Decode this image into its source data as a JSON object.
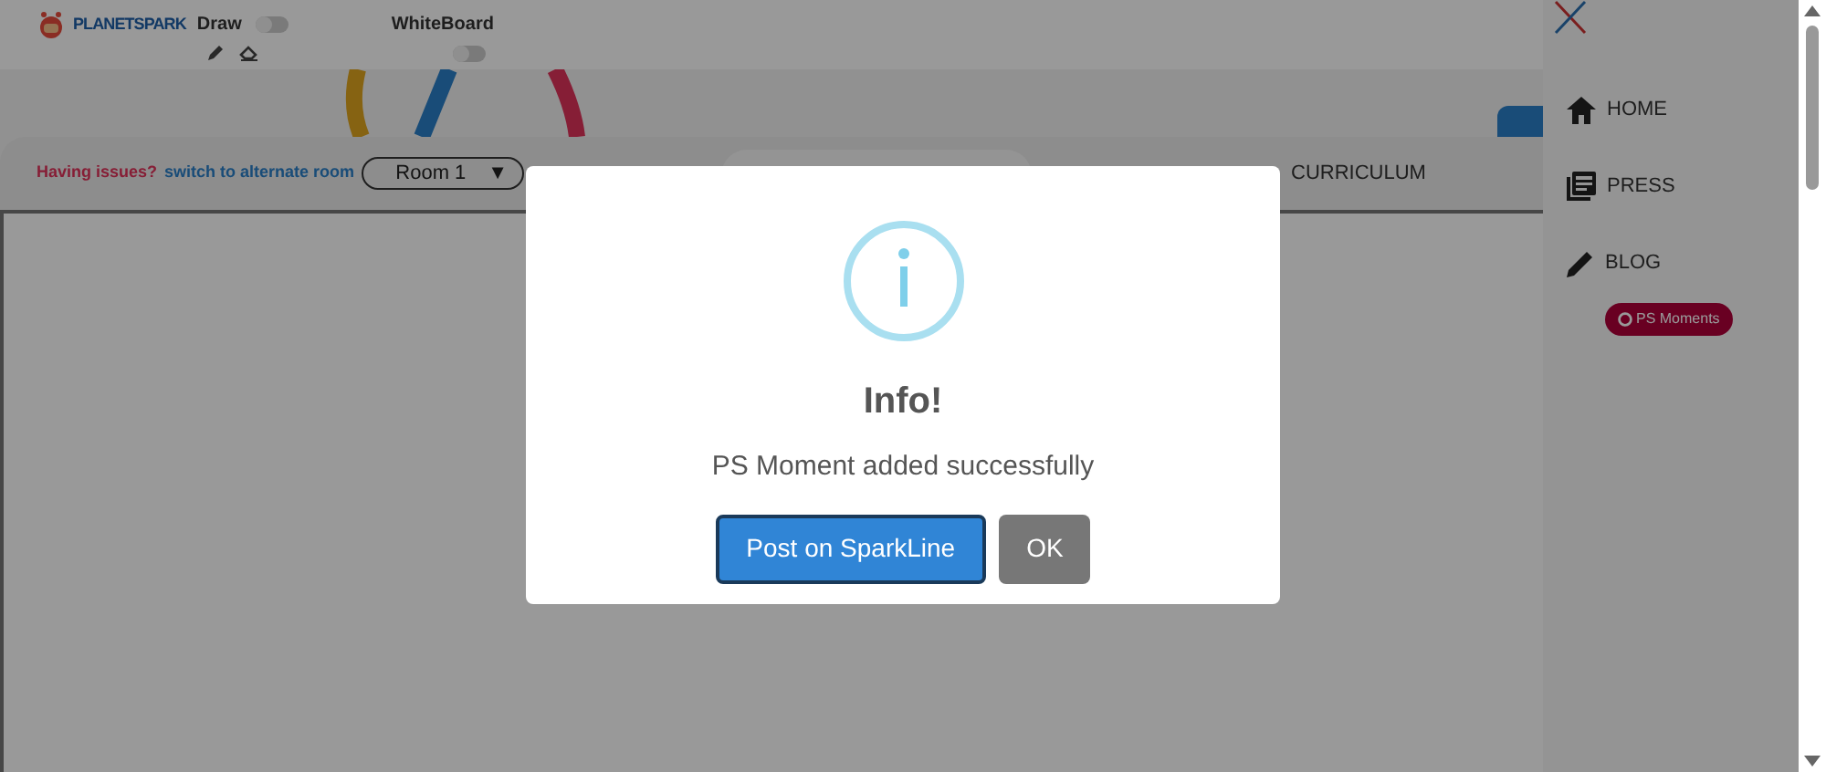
{
  "header": {
    "logo": "PLANETSPARK",
    "draw": {
      "label": "Draw",
      "on": false
    },
    "whiteboard": {
      "label": "WhiteBoard",
      "on": false
    }
  },
  "room_bar": {
    "issue_text": "Having issues?",
    "switch_link": "switch to alternate room",
    "room_select": "Room 1",
    "caret": "▼",
    "tab": "CURRICULUM"
  },
  "sidebar": {
    "items": [
      {
        "kind": "home",
        "label": "HOME"
      },
      {
        "kind": "press",
        "label": "PRESS"
      },
      {
        "kind": "blog",
        "label": "BLOG"
      }
    ],
    "badge": "PS Moments"
  },
  "dialog": {
    "title": "Info!",
    "message": "PS Moment added successfully",
    "buttons": [
      {
        "label": "Post on SparkLine",
        "kind": "primary"
      },
      {
        "label": "OK",
        "kind": "secondary"
      }
    ]
  }
}
